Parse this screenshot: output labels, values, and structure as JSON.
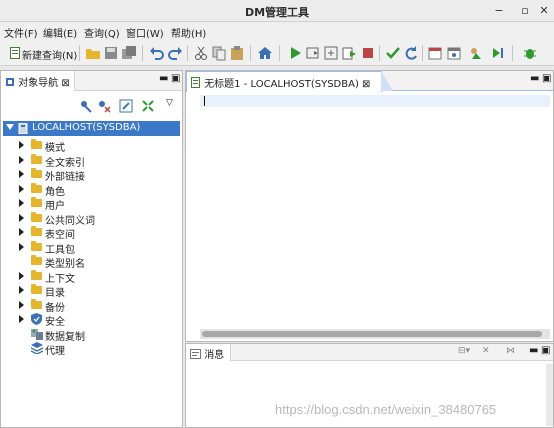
{
  "window": {
    "title": "DM管理工具",
    "controls": [
      "−",
      "▫",
      "✕"
    ]
  },
  "menu": [
    {
      "label": "文件(F)"
    },
    {
      "label": "编辑(E)"
    },
    {
      "label": "查询(Q)"
    },
    {
      "label": "窗口(W)"
    },
    {
      "label": "帮助(H)"
    }
  ],
  "toolbar": {
    "new_query_label": "新建查询(N)"
  },
  "navigator": {
    "tab_label": "对象导航",
    "tab_close": "⊠",
    "root": "LOCALHOST(SYSDBA)",
    "nodes": [
      {
        "label": "模式",
        "expandable": true,
        "icon": "folder-icon"
      },
      {
        "label": "全文索引",
        "expandable": true,
        "icon": "folder-icon"
      },
      {
        "label": "外部链接",
        "expandable": true,
        "icon": "folder-icon"
      },
      {
        "label": "角色",
        "expandable": true,
        "icon": "folder-icon"
      },
      {
        "label": "用户",
        "expandable": true,
        "icon": "folder-icon"
      },
      {
        "label": "公共同义词",
        "expandable": true,
        "icon": "folder-icon"
      },
      {
        "label": "表空间",
        "expandable": true,
        "icon": "folder-icon"
      },
      {
        "label": "工具包",
        "expandable": true,
        "icon": "folder-icon"
      },
      {
        "label": "类型别名",
        "expandable": false,
        "icon": "folder-icon"
      },
      {
        "label": "上下文",
        "expandable": true,
        "icon": "folder-icon"
      },
      {
        "label": "目录",
        "expandable": true,
        "icon": "folder-icon"
      },
      {
        "label": "备份",
        "expandable": true,
        "icon": "folder-icon"
      },
      {
        "label": "安全",
        "expandable": true,
        "icon": "shield-icon"
      },
      {
        "label": "数据复制",
        "expandable": false,
        "icon": "replication-icon"
      },
      {
        "label": "代理",
        "expandable": false,
        "icon": "agent-icon"
      }
    ]
  },
  "editor": {
    "tab_label": "无标题1 - LOCALHOST(SYSDBA)",
    "tab_close": "⊠"
  },
  "messages": {
    "tab_label": "消息"
  },
  "watermark": "https://blog.csdn.net/weixin_38480765",
  "colors": {
    "selection": "#3b78c8",
    "folder": "#e6b52e",
    "accent_tab": "#9ebde6"
  }
}
